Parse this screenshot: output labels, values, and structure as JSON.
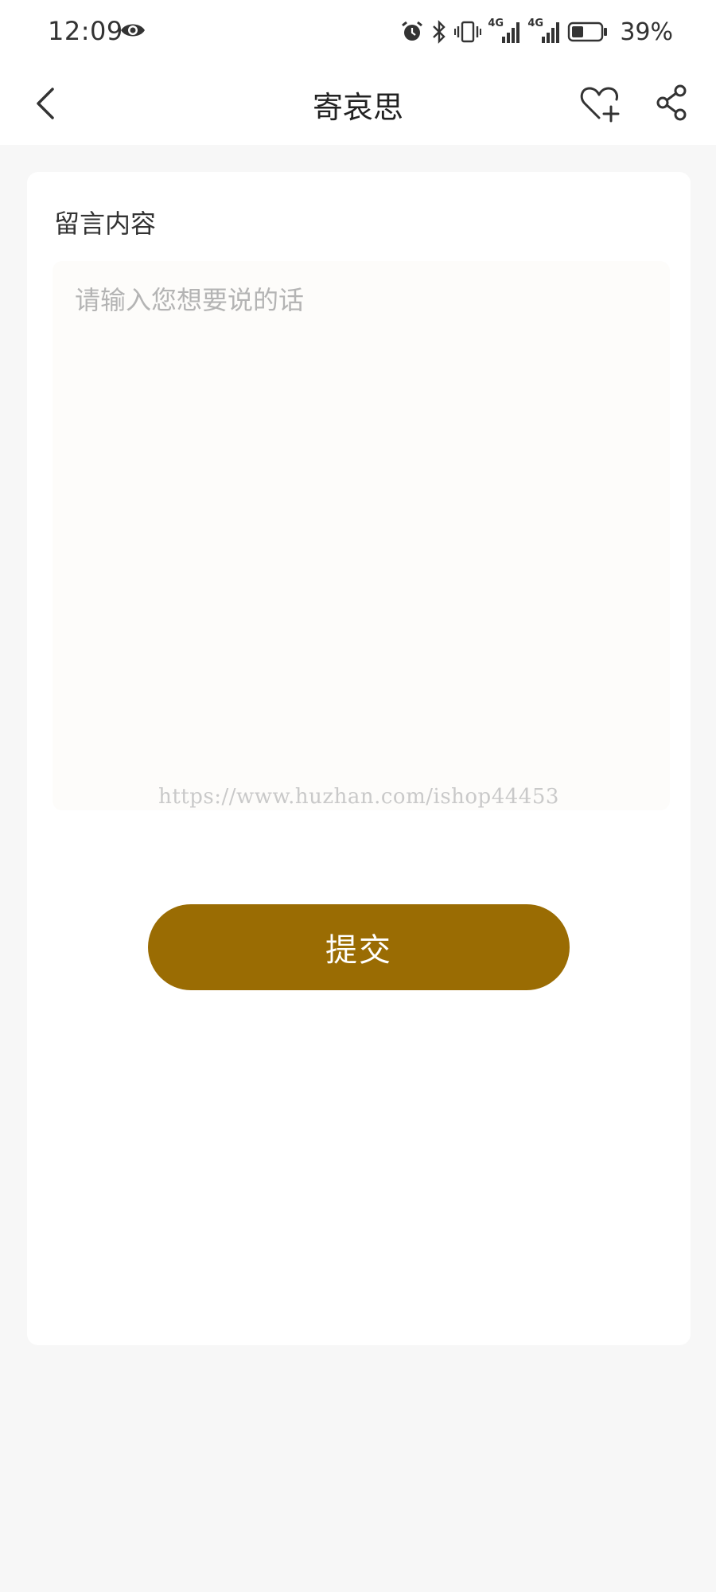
{
  "status_bar": {
    "time": "12:09",
    "battery_percent": "39%",
    "battery_level": 0.39,
    "network_label_1": "4G",
    "network_label_2": "4G",
    "icons": [
      "eye-icon",
      "alarm-icon",
      "bluetooth-icon",
      "vibrate-icon",
      "signal-icon",
      "signal-icon",
      "battery-icon"
    ]
  },
  "nav": {
    "title": "寄哀思",
    "icons": [
      "back-arrow-icon",
      "heart-plus-icon",
      "share-icon"
    ]
  },
  "form": {
    "label": "留言内容",
    "placeholder": "请输入您想要说的话",
    "value": "",
    "watermark": "https://www.huzhan.com/ishop44453",
    "submit_label": "提交"
  },
  "colors": {
    "accent": "#9a6c03",
    "page_background": "#f7f7f7",
    "card_background": "#ffffff",
    "input_background": "#fdfcfa",
    "placeholder": "#b4b4b4"
  }
}
